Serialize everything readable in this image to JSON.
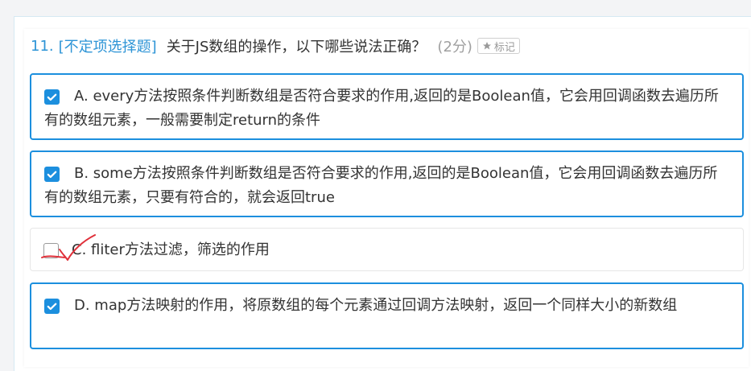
{
  "question": {
    "number": "11.",
    "type": "[不定项选择题]",
    "text": "关于JS数组的操作，以下哪些说法正确？",
    "score": "(2分)",
    "mark_label": "标记"
  },
  "options": [
    {
      "text": "A. every方法按照条件判断数组是否符合要求的作用,返回的是Boolean值，它会用回调函数去遍历所有的数组元素，一般需要制定return的条件",
      "checked": true
    },
    {
      "text": "B. some方法按照条件判断数组是否符合要求的作用,返回的是Boolean值，它会用回调函数去遍历所有的数组元素，只要有符合的，就会返回true",
      "checked": true
    },
    {
      "text": "C. fliter方法过滤，筛选的作用",
      "checked": false
    },
    {
      "text": "D. map方法映射的作用，将原数组的每个元素通过回调方法映射，返回一个同样大小的新数组",
      "checked": true
    }
  ],
  "colors": {
    "accent": "#1c8fde",
    "question_blue": "#2d94d6",
    "red_annotation": "#e0303a"
  },
  "icons": [
    "star-icon",
    "checkmark-icon",
    "red-check-annotation-icon"
  ]
}
